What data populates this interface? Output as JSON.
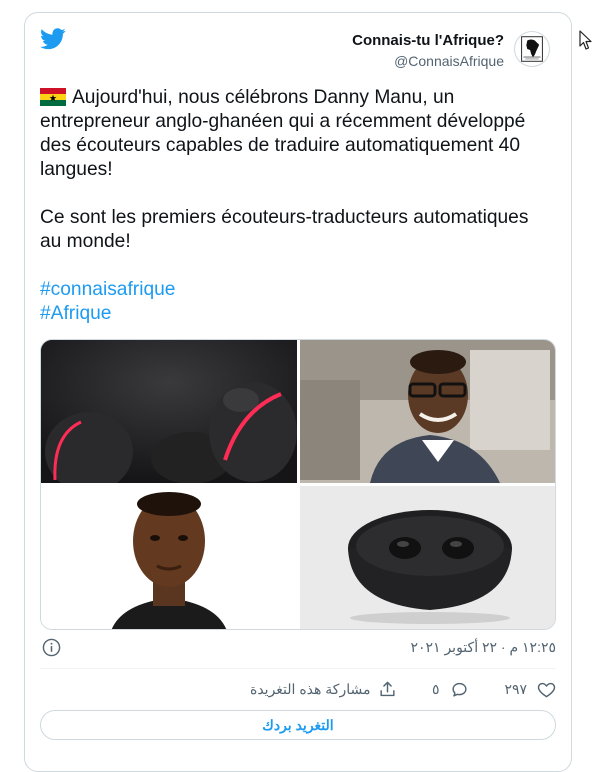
{
  "tweet": {
    "author": {
      "display_name": "Connais-tu l'Afrique?",
      "handle": "@ConnaisAfrique",
      "avatar_icon": "africa-map-logo"
    },
    "flag_icon": "ghana-flag",
    "paragraphs": [
      "Aujourd'hui, nous célébrons Danny Manu, un entrepreneur anglo-ghanéen qui a récemment développé des écouteurs capables de traduire automatiquement 40 langues!",
      "Ce sont les premiers écouteurs-traducteurs automatiques au monde!"
    ],
    "hashtags": [
      "#connaisafrique",
      "#Afrique"
    ],
    "timestamp": "١٢:٢٥ م · ٢٢ أكتوبر ٢٠٢١",
    "actions": {
      "likes": "٢٩٧",
      "replies": "٥",
      "share_label": "مشاركة هذه التغريدة"
    },
    "reply_button_label": "التغريد بردك"
  },
  "colors": {
    "accent": "#1d9bf0",
    "muted": "#536471",
    "border": "#cfd9de"
  }
}
